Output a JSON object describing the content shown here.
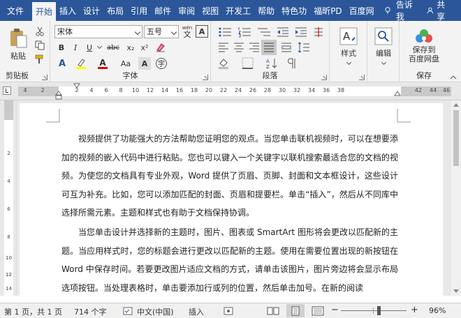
{
  "tabs": [
    "文件",
    "开始",
    "插入",
    "设计",
    "布局",
    "引用",
    "邮件",
    "审阅",
    "视图",
    "开发工",
    "帮助",
    "特色功",
    "福昕PD",
    "百度网"
  ],
  "tell_me": "告诉我",
  "share": "共享",
  "clipboard": {
    "paste": "粘贴",
    "label": "剪贴板"
  },
  "font": {
    "name": "宋体",
    "size": "五号",
    "wen": "wén",
    "wen_char": "文",
    "a_box": "A",
    "bold": "B",
    "italic": "I",
    "underline": "U",
    "strike": "abc",
    "sub": "x₂",
    "sup": "x²",
    "a": "A",
    "aa": "Aa",
    "label": "字体"
  },
  "paragraph": {
    "label": "段落"
  },
  "styles": {
    "label": "样式"
  },
  "editing": {
    "label": "编辑"
  },
  "save": {
    "line1": "保存到",
    "line2": "百度网盘",
    "label": "保存"
  },
  "ruler_numbers": [
    "4",
    "2",
    "2",
    "4",
    "6",
    "8",
    "10",
    "12",
    "14",
    "16",
    "18",
    "20",
    "22",
    "24",
    "26",
    "28",
    "30",
    "32",
    "34",
    "36",
    "38",
    "42",
    "44",
    "46"
  ],
  "vruler_numbers": [
    "2",
    "4",
    "6",
    "8",
    "10",
    "12",
    "14"
  ],
  "document": {
    "p1": "视频提供了功能强大的方法帮助您证明您的观点。当您单击联机视频时，可以在想要添加的视频的嵌入代码中进行粘贴。您也可以键入一个关键字以联机搜索最适合您的文档的视频。为使您的文档具有专业外观，Word 提供了页眉、页脚、封面和文本框设计，这些设计可互为补充。比如，您可以添加匹配的封面、页眉和提要栏。单击“插入”，然后从不同库中选择所需元素。主题和样式也有助于文档保持协调。",
    "p2": "当您单击设计并选择新的主题时，图片、图表或 SmartArt 图形将会更改以匹配新的主题。当应用样式时，您的标题会进行更改以匹配新的主题。使用在需要位置出现的新按钮在 Word 中保存时间。若要更改图片适应文档的方式，请单击该图片，图片旁边将会显示布局选项按钮。当处理表格时，单击要添加行或列的位置，然后单击加号。在新的阅读"
  },
  "status": {
    "page": "第 1 页，共 1 页",
    "words": "714 个字",
    "lang": "中文(中国)",
    "insert": "插入",
    "zoom": "96%",
    "minus": "−",
    "plus": "+"
  },
  "colors": {
    "ribbon_blue": "#2b579a",
    "ribbon_bg": "#f3f3f3"
  }
}
